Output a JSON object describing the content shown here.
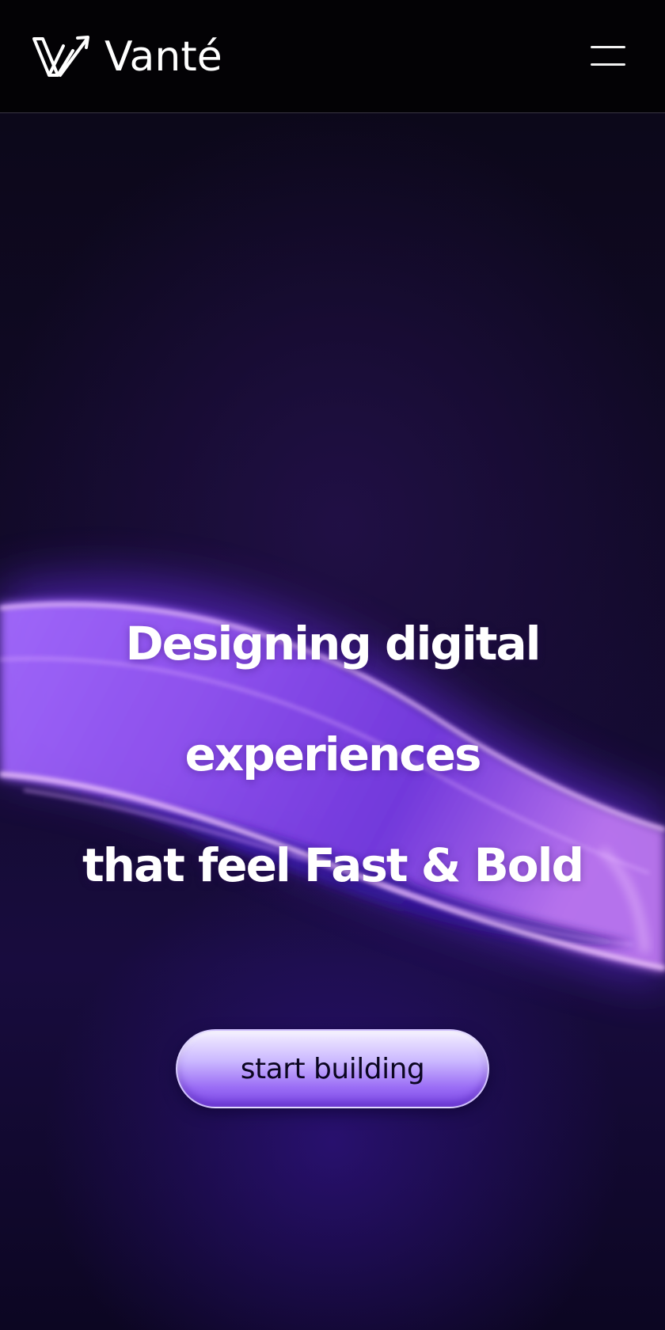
{
  "header": {
    "brand_name": "Vanté",
    "logo_icon": "vante-logo-mark",
    "menu_icon": "hamburger-menu-icon"
  },
  "hero": {
    "headline_lines": [
      "Designing digital",
      "experiences",
      "that feel Fast & Bold"
    ],
    "cta_label": "start building"
  },
  "colors": {
    "background": "#07040f",
    "header_background": "#030205",
    "accent_purple": "#8a4dff",
    "wave_light": "#d6a2ff",
    "text": "#ffffff",
    "button_text": "#0b0620"
  }
}
